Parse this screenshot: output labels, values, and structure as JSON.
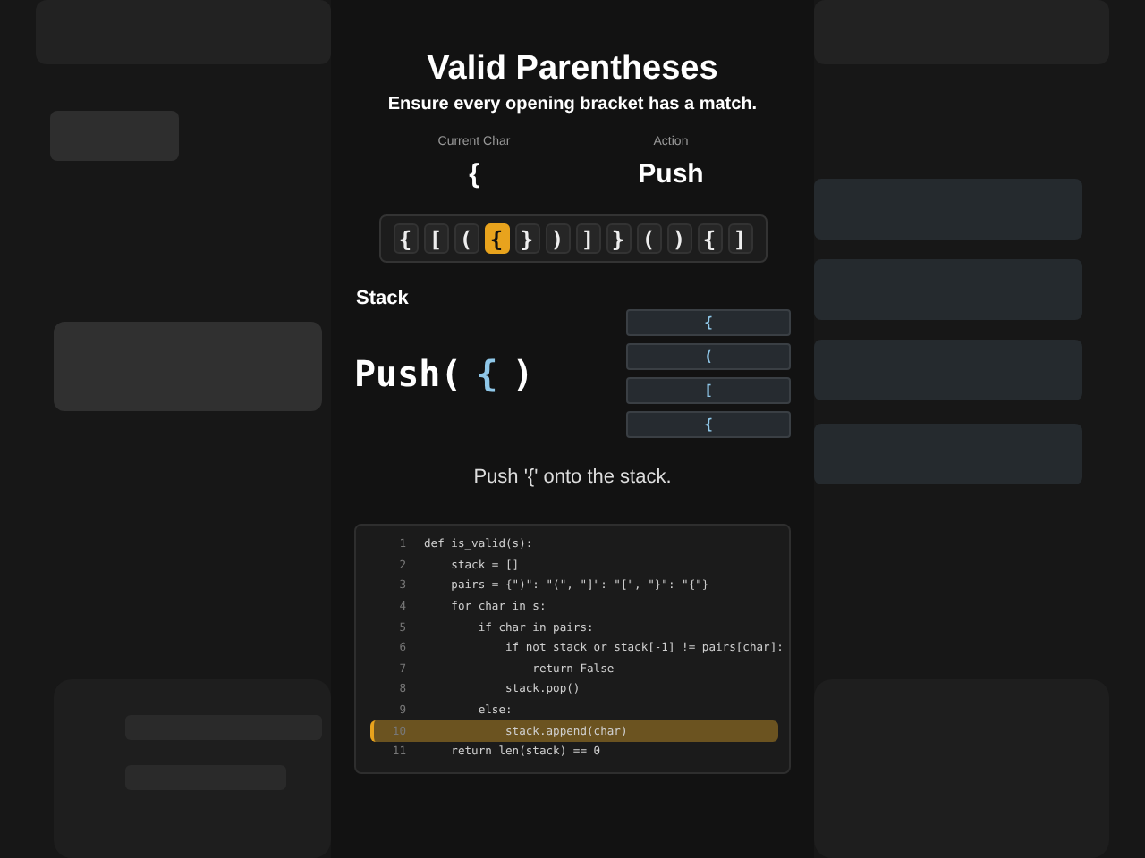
{
  "title": "Valid Parentheses",
  "subtitle": "Ensure every opening bracket has a match.",
  "status": [
    {
      "label": "Current Char",
      "value": "{"
    },
    {
      "label": "Action",
      "value": "Push"
    }
  ],
  "tokens": [
    {
      "char": "{",
      "selected": false
    },
    {
      "char": "[",
      "selected": false
    },
    {
      "char": "(",
      "selected": false
    },
    {
      "char": "{",
      "selected": true
    },
    {
      "char": "}",
      "selected": false
    },
    {
      "char": ")",
      "selected": false
    },
    {
      "char": "]",
      "selected": false
    },
    {
      "char": "}",
      "selected": false
    },
    {
      "char": "(",
      "selected": false
    },
    {
      "char": ")",
      "selected": false
    },
    {
      "char": "{",
      "selected": false
    },
    {
      "char": "]",
      "selected": false
    }
  ],
  "stack": {
    "label": "Stack",
    "operation": "Push(",
    "operand": "{",
    "close": ")",
    "items": [
      "{",
      "(",
      "[",
      "{"
    ]
  },
  "message": "Push '{' onto the stack.",
  "code": [
    {
      "number": "1",
      "text": "def is_valid(s):",
      "selected": false
    },
    {
      "number": "2",
      "text": "    stack = []",
      "selected": false
    },
    {
      "number": "3",
      "text": "    pairs = {\")\": \"(\", \"]\": \"[\", \"}\": \"{\"}",
      "selected": false
    },
    {
      "number": "4",
      "text": "    for char in s:",
      "selected": false
    },
    {
      "number": "5",
      "text": "        if char in pairs:",
      "selected": false
    },
    {
      "number": "6",
      "text": "            if not stack or stack[-1] != pairs[char]:",
      "selected": false
    },
    {
      "number": "7",
      "text": "                return False",
      "selected": false
    },
    {
      "number": "8",
      "text": "            stack.pop()",
      "selected": false
    },
    {
      "number": "9",
      "text": "        else:",
      "selected": false
    },
    {
      "number": "10",
      "text": "            stack.append(char)",
      "selected": true
    },
    {
      "number": "11",
      "text": "    return len(stack) == 0",
      "selected": false
    }
  ]
}
